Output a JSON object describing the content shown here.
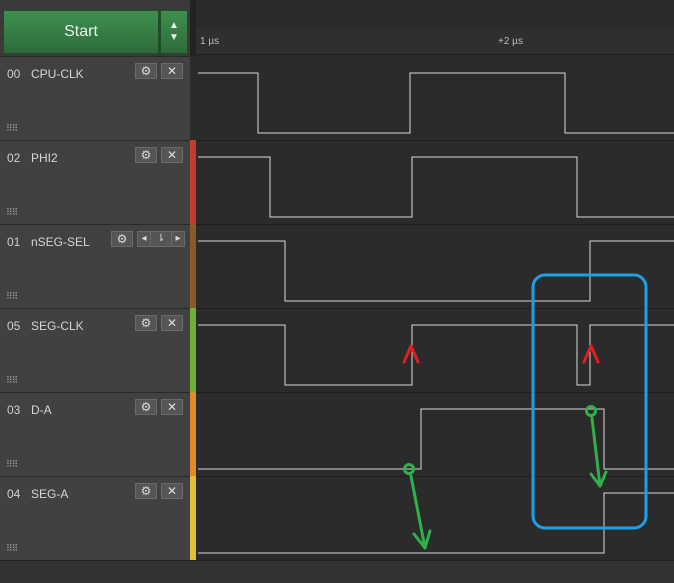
{
  "toolbar": {
    "start_label": "Start",
    "arrow_up": "▲",
    "arrow_down": "▼"
  },
  "ruler": {
    "left_label": "1 µs",
    "mid_label": "+2 µs"
  },
  "channels": [
    {
      "num": "00",
      "name": "CPU-CLK",
      "color": "#2a2a2a"
    },
    {
      "num": "02",
      "name": "PHI2",
      "color": "#c73a2f"
    },
    {
      "num": "01",
      "name": "nSEG-SEL",
      "color": "#8a5a2a"
    },
    {
      "num": "05",
      "name": "SEG-CLK",
      "color": "#6fb03a"
    },
    {
      "num": "03",
      "name": "D-A",
      "color": "#e08a2a"
    },
    {
      "num": "04",
      "name": "SEG-A",
      "color": "#e0c03a"
    }
  ],
  "icons": {
    "gear": "⚙",
    "close": "✕",
    "grip": "⠿⠿",
    "edge": "⇂"
  },
  "annotations": {
    "highlight_box": "#1ea0e8",
    "red_arrow": "#e02020",
    "green_arrow": "#2fb04a"
  }
}
